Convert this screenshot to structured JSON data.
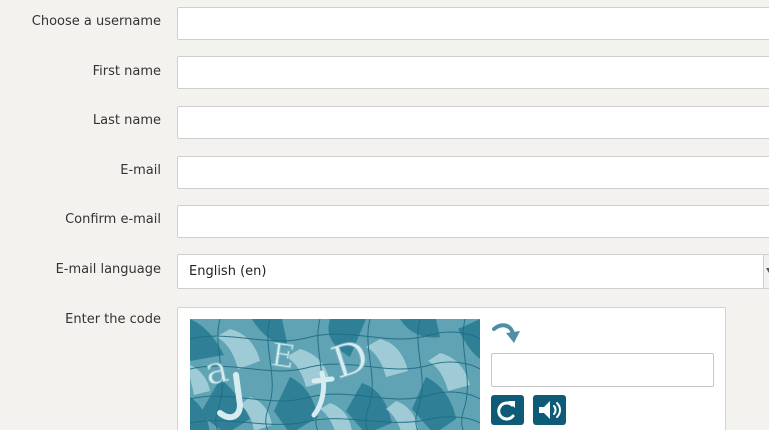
{
  "form": {
    "username_label": "Choose a username",
    "first_name_label": "First name",
    "last_name_label": "Last name",
    "email_label": "E-mail",
    "confirm_email_label": "Confirm e-mail",
    "email_language_label": "E-mail language",
    "email_language_value": "English (en)",
    "captcha_label": "Enter the code"
  },
  "captcha": {
    "reload_icon": "refresh-icon",
    "audio_icon": "speaker-icon",
    "accent_color": "#0e5b78"
  }
}
